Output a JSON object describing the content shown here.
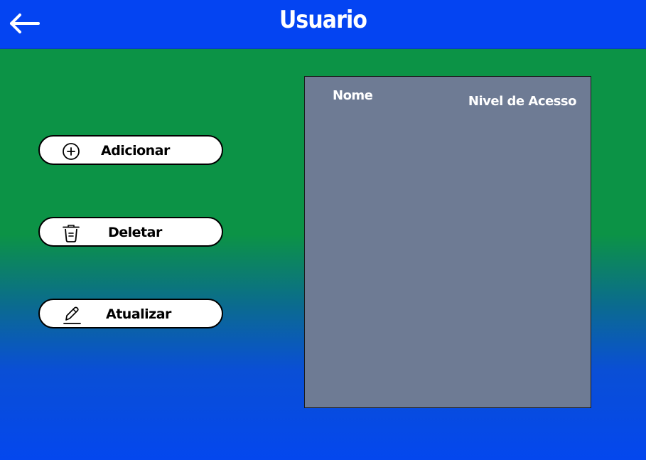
{
  "header": {
    "title": "Usuario",
    "back_icon": "arrow-left-icon",
    "background": "#0444f2"
  },
  "actions": {
    "add": {
      "label": "Adicionar",
      "icon": "plus-circle-icon"
    },
    "delete": {
      "label": "Deletar",
      "icon": "trash-icon"
    },
    "update": {
      "label": "Atualizar",
      "icon": "pencil-icon"
    }
  },
  "table": {
    "columns": [
      "Nome",
      "Nivel de Acesso"
    ],
    "rows": [],
    "background": "#6e7b94"
  },
  "colors": {
    "gradient_top": "#0c9346",
    "gradient_bottom": "#0447ee"
  }
}
